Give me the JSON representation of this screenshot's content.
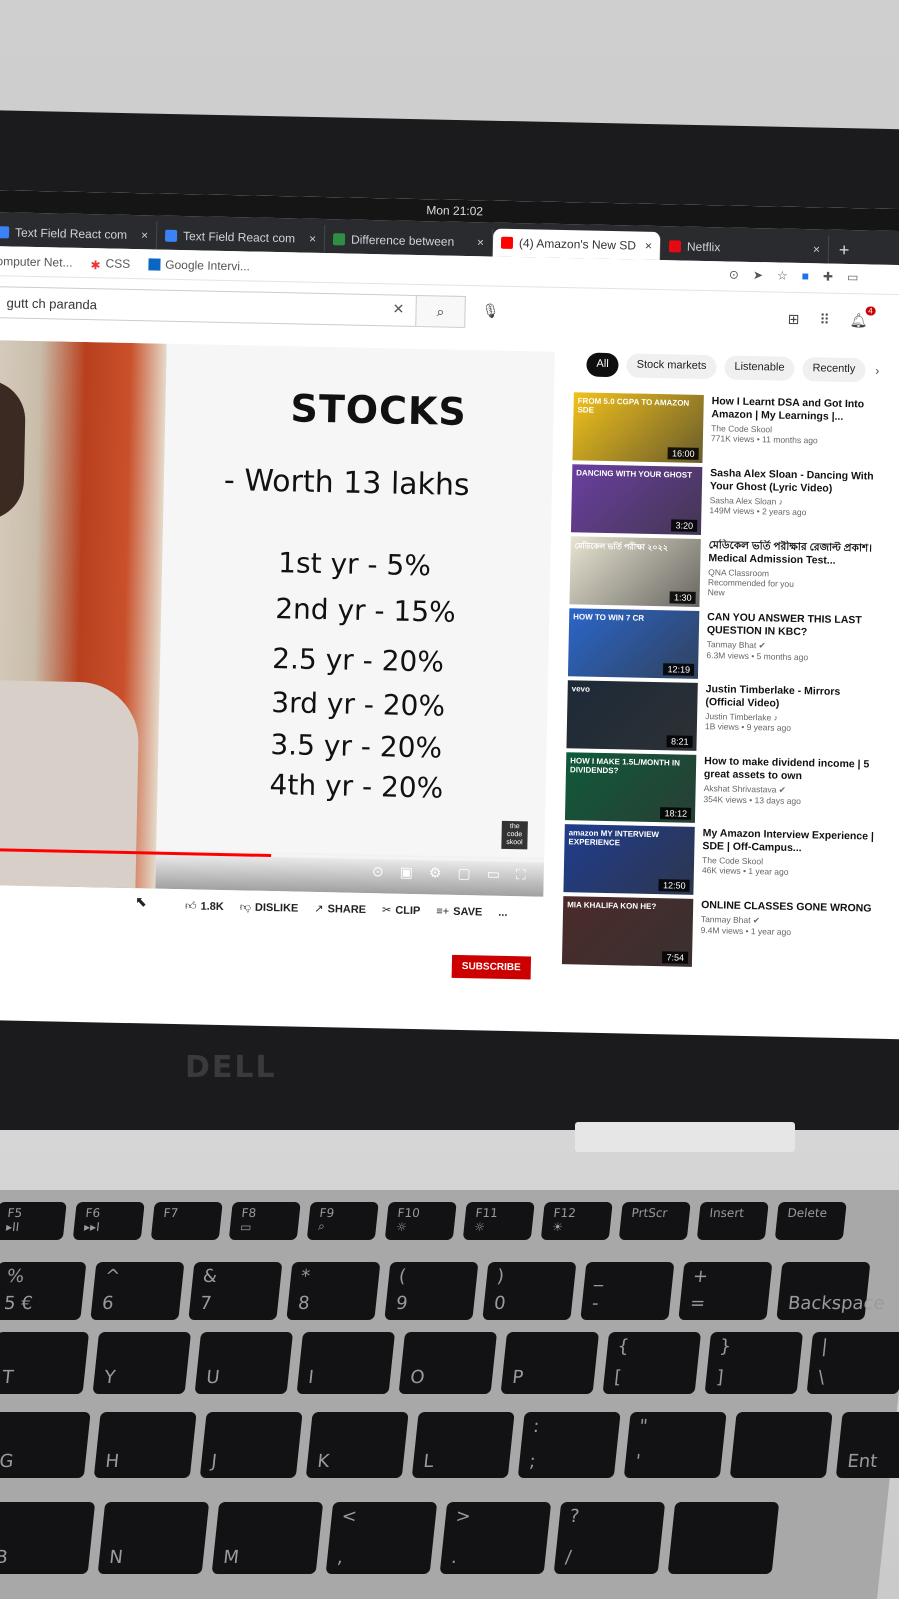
{
  "system": {
    "clock": "Mon 21:02"
  },
  "browser": {
    "tabs": [
      {
        "title": "Text Field React com",
        "favicon_color": "#3b82f6",
        "active": false
      },
      {
        "title": "Text Field React com",
        "favicon_color": "#3b82f6",
        "active": false
      },
      {
        "title": "Difference between",
        "favicon_color": "#2f8d46",
        "active": false
      },
      {
        "title": "(4) Amazon's New SD",
        "favicon_color": "#ff0000",
        "active": true
      },
      {
        "title": "Netflix",
        "favicon_color": "#e50914",
        "active": false
      }
    ],
    "close_glyph": "×",
    "newtab_glyph": "+",
    "bookmarks": [
      {
        "label": "omputer Net...",
        "icon": "none"
      },
      {
        "label": "CSS",
        "icon": "asterisk-icon"
      },
      {
        "label": "Google Intervi...",
        "icon": "linkedin-icon"
      }
    ]
  },
  "youtube": {
    "search": {
      "value": "gutt ch paranda"
    },
    "notification_count": "4",
    "chips": [
      {
        "label": "All",
        "active": true
      },
      {
        "label": "Stock markets",
        "active": false
      },
      {
        "label": "Listenable",
        "active": false
      },
      {
        "label": "Recently",
        "active": false
      }
    ],
    "video": {
      "progress": 0.52,
      "slide": {
        "title": "STOCKS",
        "subtitle": "- Worth 13 lakhs",
        "lines": [
          "1st yr - 5%",
          "2nd yr - 15%",
          "2.5 yr - 20%",
          "3rd yr - 20%",
          "3.5 yr - 20%",
          "4th yr - 20%"
        ]
      },
      "watermark": "the code skool"
    },
    "actions": {
      "like_count": "1.8K",
      "dislike": "DISLIKE",
      "share": "SHARE",
      "clip": "CLIP",
      "save": "SAVE",
      "more": "...",
      "subscribe": "SUBSCRIBE"
    },
    "recommendations": [
      {
        "title": "How I Learnt DSA and Got Into Amazon | My Learnings |...",
        "channel": "The Code Skool",
        "meta": "771K views • 11 months ago",
        "duration": "16:00",
        "thumb_label": "FROM 5.0 CGPA TO AMAZON SDE",
        "thumb_color": "#f2c21a"
      },
      {
        "title": "Sasha Alex Sloan - Dancing With Your Ghost (Lyric Video)",
        "channel": "Sasha Alex Sloan ♪",
        "meta": "149M views • 2 years ago",
        "duration": "3:20",
        "thumb_label": "DANCING WITH YOUR GHOST",
        "thumb_color": "#6b3fa0"
      },
      {
        "title": "মেডিকেল ভর্তি পরীক্ষার রেজাল্ট প্রকাশ। Medical Admission Test...",
        "channel": "QNA Classroom",
        "meta": "Recommended for you",
        "meta2": "New",
        "duration": "1:30",
        "thumb_label": "মেডিকেল ভর্তি পরীক্ষা ২০২২",
        "thumb_color": "#e9e4d2"
      },
      {
        "title": "CAN YOU ANSWER THIS LAST QUESTION IN KBC?",
        "channel": "Tanmay Bhat ✔",
        "meta": "6.3M views • 5 months ago",
        "duration": "12:19",
        "thumb_label": "HOW TO WIN 7 CR",
        "thumb_color": "#2b66c9"
      },
      {
        "title": "Justin Timberlake - Mirrors (Official Video)",
        "channel": "Justin Timberlake ♪",
        "meta": "1B views • 9 years ago",
        "duration": "8:21",
        "thumb_label": "vevo",
        "thumb_color": "#1d2a38"
      },
      {
        "title": "How to make dividend income | 5 great assets to own",
        "channel": "Akshat Shrivastava ✔",
        "meta": "354K views • 13 days ago",
        "duration": "18:12",
        "thumb_label": "HOW I MAKE 1.5L/MONTH IN DIVIDENDS?",
        "thumb_color": "#0f5a3a"
      },
      {
        "title": "My Amazon Interview Experience | SDE | Off-Campus...",
        "channel": "The Code Skool",
        "meta": "46K views • 1 year ago",
        "duration": "12:50",
        "thumb_label": "amazon MY INTERVIEW EXPERIENCE",
        "thumb_color": "#1f3d8f"
      },
      {
        "title": "ONLINE CLASSES GONE WRONG",
        "channel": "Tanmay Bhat ✔",
        "meta": "9.4M views • 1 year ago",
        "duration": "7:54",
        "thumb_label": "MIA KHALIFA KON HE?",
        "thumb_color": "#4b2a2a"
      }
    ]
  },
  "laptop": {
    "brand": "DELL"
  },
  "keyboard": {
    "rows": [
      [
        {
          "top": "F5",
          "bot": "▸II"
        },
        {
          "top": "F6",
          "bot": "▸▸I"
        },
        {
          "top": "F7",
          "bot": ""
        },
        {
          "top": "F8",
          "bot": "▭"
        },
        {
          "top": "F9",
          "bot": "⌕"
        },
        {
          "top": "F10",
          "bot": "☼"
        },
        {
          "top": "F11",
          "bot": "☼"
        },
        {
          "top": "F12",
          "bot": "☀"
        },
        {
          "top": "PrtScr",
          "bot": ""
        },
        {
          "top": "Insert",
          "bot": ""
        },
        {
          "top": "Delete",
          "bot": ""
        }
      ],
      [
        {
          "top": "%",
          "bot": "5 €"
        },
        {
          "top": "^",
          "bot": "6"
        },
        {
          "top": "&",
          "bot": "7"
        },
        {
          "top": "*",
          "bot": "8"
        },
        {
          "top": "(",
          "bot": "9"
        },
        {
          "top": ")",
          "bot": "0"
        },
        {
          "top": "_",
          "bot": "-"
        },
        {
          "top": "+",
          "bot": "="
        },
        {
          "top": "",
          "bot": "Backspace"
        }
      ],
      [
        {
          "top": "",
          "bot": "T"
        },
        {
          "top": "",
          "bot": "Y"
        },
        {
          "top": "",
          "bot": "U"
        },
        {
          "top": "",
          "bot": "I"
        },
        {
          "top": "",
          "bot": "O"
        },
        {
          "top": "",
          "bot": "P"
        },
        {
          "top": "{",
          "bot": "["
        },
        {
          "top": "}",
          "bot": "]"
        },
        {
          "top": "|",
          "bot": "\\"
        }
      ],
      [
        {
          "top": "",
          "bot": "G"
        },
        {
          "top": "",
          "bot": "H"
        },
        {
          "top": "",
          "bot": "J"
        },
        {
          "top": "",
          "bot": "K"
        },
        {
          "top": "",
          "bot": "L"
        },
        {
          "top": ":",
          "bot": ";"
        },
        {
          "top": "\"",
          "bot": "'"
        },
        {
          "top": "",
          "bot": ""
        },
        {
          "top": "",
          "bot": "Ent"
        }
      ],
      [
        {
          "top": "",
          "bot": "B"
        },
        {
          "top": "",
          "bot": "N"
        },
        {
          "top": "",
          "bot": "M"
        },
        {
          "top": "<",
          "bot": ","
        },
        {
          "top": ">",
          "bot": "."
        },
        {
          "top": "?",
          "bot": "/"
        },
        {
          "top": "",
          "bot": ""
        }
      ]
    ]
  }
}
